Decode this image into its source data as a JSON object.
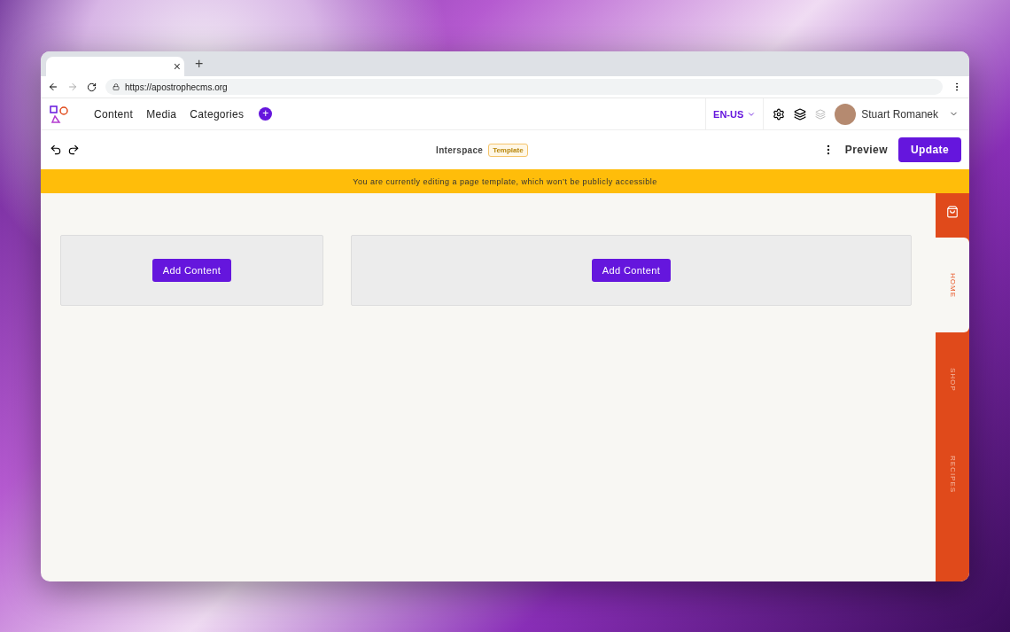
{
  "browser": {
    "tab_close": "×",
    "new_tab": "+",
    "url": "https://apostrophecms.org"
  },
  "admin_bar": {
    "nav": [
      "Content",
      "Media",
      "Categories"
    ],
    "add": "+",
    "locale": "EN-US",
    "user": "Stuart Romanek"
  },
  "context_bar": {
    "title": "Interspace",
    "badge": "Template",
    "preview": "Preview",
    "update": "Update"
  },
  "banner": "You are currently editing a page template, which won’t be publicly accessible",
  "areas": [
    {
      "button": "Add Content",
      "kind": "narrow"
    },
    {
      "button": "Add Content",
      "kind": "wide"
    }
  ],
  "side_tabs": [
    {
      "label": "HOME",
      "selected": true
    },
    {
      "label": "SHOP",
      "selected": false
    },
    {
      "label": "RECIPES",
      "selected": false
    }
  ]
}
